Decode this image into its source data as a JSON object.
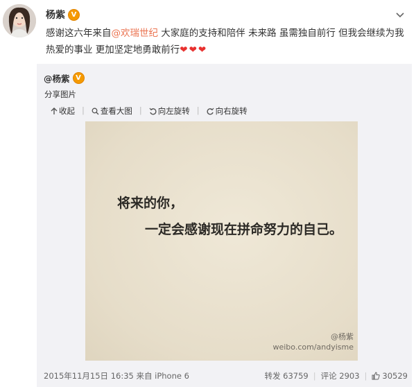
{
  "post": {
    "author": "杨紫",
    "verified_badge": "V",
    "text_before_mention": "感谢这六年来自",
    "mention": "@欢瑞世纪",
    "text_after_mention": " 大家庭的支持和陪伴 未来路 虽需独自前行 但我会继续为我热爱的事业 更加坚定地勇敢前行",
    "hearts": "❤❤❤"
  },
  "repost": {
    "author": "@杨紫",
    "verified_badge": "V",
    "share_label": "分享图片",
    "toolbar": {
      "collapse": "收起",
      "view_large": "查看大图",
      "rotate_left": "向左旋转",
      "rotate_right": "向右旋转"
    },
    "image": {
      "line1": "将来的你，",
      "line2": "一定会感谢现在拼命努力的自己。",
      "watermark_account": "@杨紫",
      "watermark_url": "weibo.com/andyisme"
    },
    "footer": {
      "timestamp": "2015年11月15日 16:35 来自 iPhone 6",
      "repost": "转发 63759",
      "comment": "评论 2903",
      "likes": "30529"
    }
  },
  "colors": {
    "accent": "#eb7350",
    "heart": "#e8312f",
    "verified": "#f59a00",
    "repost_bg": "#f2f2f5"
  }
}
